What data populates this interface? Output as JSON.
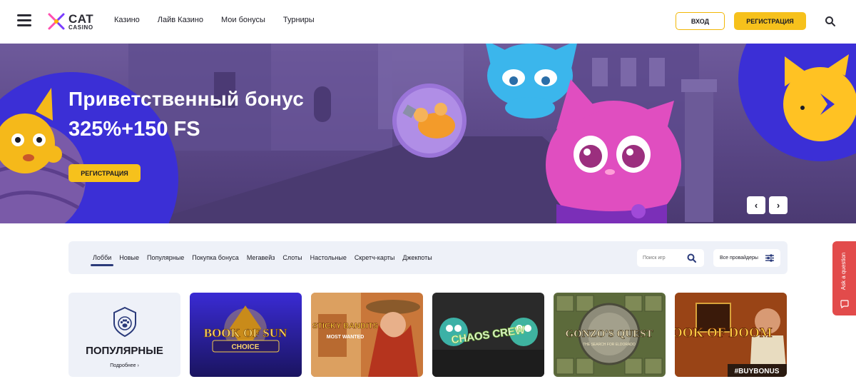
{
  "header": {
    "logo": {
      "cat": "CAT",
      "casino": "CASINO"
    },
    "nav": [
      "Казино",
      "Лайв Казино",
      "Мои бонусы",
      "Турниры"
    ],
    "login_label": "ВХОД",
    "register_label": "РЕГИСТРАЦИЯ"
  },
  "hero": {
    "title": "Приветственный бонус",
    "subtitle": "325%+150 FS",
    "cta_label": "РЕГИСТРАЦИЯ",
    "prev_symbol": "‹",
    "next_symbol": "›"
  },
  "toolbar": {
    "tabs": [
      "Лобби",
      "Новые",
      "Популярные",
      "Покупка бонуса",
      "Мегавейз",
      "Слоты",
      "Настольные",
      "Скретч-карты",
      "Джекпоты"
    ],
    "active_tab": "Лобби",
    "search_placeholder": "Поиск игр",
    "providers_label": "Все провайдеры"
  },
  "popular": {
    "title": "ПОПУЛЯРНЫЕ",
    "more_label": "Подробнее ›"
  },
  "games": [
    {
      "title": "BOOK OF SUN",
      "subtitle": "CHOICE"
    },
    {
      "title": "STICKY BANDITS",
      "subtitle": "MOST WANTED"
    },
    {
      "title": "CHAOS CREW",
      "subtitle": ""
    },
    {
      "title": "GONZO'S QUEST",
      "subtitle": "THE SEARCH FOR ELDORADO"
    },
    {
      "title": "BOOK OF DOOM",
      "subtitle": "#BUYBONUS"
    }
  ],
  "side_tab": {
    "label": "Ask a question"
  },
  "colors": {
    "accent_yellow": "#f6c11c",
    "navy": "#2a3a7a",
    "side_red": "#e24b4b"
  }
}
